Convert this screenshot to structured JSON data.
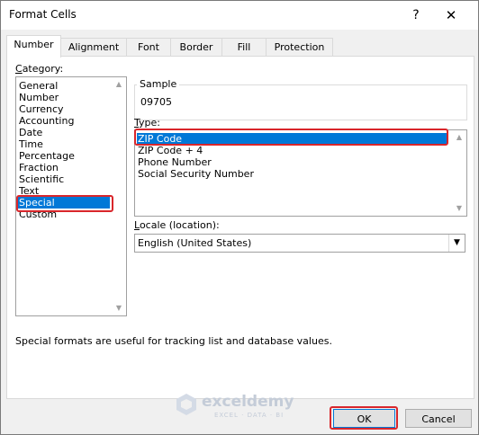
{
  "window": {
    "title": "Format Cells",
    "help_glyph": "?",
    "close_glyph": "✕"
  },
  "tabs": [
    {
      "label": "Number",
      "active": true
    },
    {
      "label": "Alignment",
      "active": false
    },
    {
      "label": "Font",
      "active": false
    },
    {
      "label": "Border",
      "active": false
    },
    {
      "label": "Fill",
      "active": false
    },
    {
      "label": "Protection",
      "active": false
    }
  ],
  "category": {
    "label": "Category:",
    "items": [
      "General",
      "Number",
      "Currency",
      "Accounting",
      "Date",
      "Time",
      "Percentage",
      "Fraction",
      "Scientific",
      "Text",
      "Special",
      "Custom"
    ],
    "selected": "Special"
  },
  "sample": {
    "label": "Sample",
    "value": "09705"
  },
  "type": {
    "label": "Type:",
    "items": [
      "ZIP Code",
      "ZIP Code + 4",
      "Phone Number",
      "Social Security Number"
    ],
    "selected": "ZIP Code"
  },
  "locale": {
    "label": "Locale (location):",
    "value": "English (United States)"
  },
  "description": "Special formats are useful for tracking list and database values.",
  "watermark": {
    "name": "exceldemy",
    "tagline": "EXCEL · DATA · BI"
  },
  "buttons": {
    "ok": "OK",
    "cancel": "Cancel"
  },
  "colors": {
    "selection": "#0078d7",
    "highlight_box": "#d9262b"
  }
}
